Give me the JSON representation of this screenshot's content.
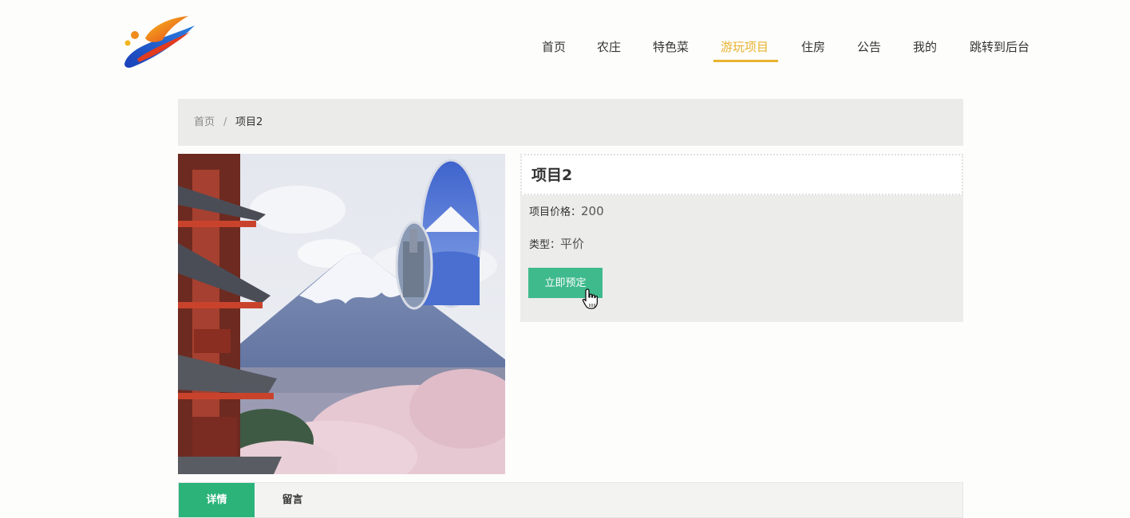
{
  "nav": {
    "items": [
      {
        "label": "首页"
      },
      {
        "label": "农庄"
      },
      {
        "label": "特色菜"
      },
      {
        "label": "游玩项目"
      },
      {
        "label": "住房"
      },
      {
        "label": "公告"
      },
      {
        "label": "我的"
      },
      {
        "label": "跳转到后台"
      }
    ],
    "active": "游玩项目"
  },
  "breadcrumb": {
    "home": "首页",
    "separator": "/",
    "current": "项目2"
  },
  "product": {
    "title": "项目2",
    "price_label": "项目价格：",
    "price_value": "200",
    "type_label": "类型：",
    "type_value": "平价",
    "book_button": "立即预定"
  },
  "tabs": {
    "detail": "详情",
    "comment": "留言"
  },
  "colors": {
    "accent": "#e8b32e",
    "button": "#3fba8c",
    "tab_active": "#2bb37a"
  },
  "icons": {
    "logo": "swoosh-logo",
    "cursor": "hand-pointer-icon"
  }
}
